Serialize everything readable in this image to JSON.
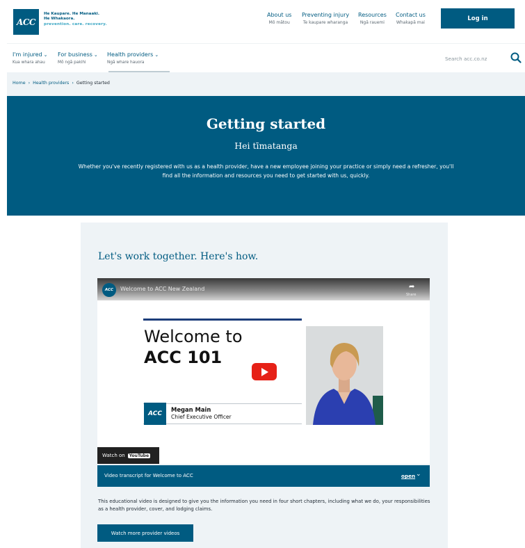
{
  "header": {
    "logo_text": "ACC",
    "tagline_1": "He Kaupare. He Manaaki.",
    "tagline_2": "He Whakaora.",
    "tagline_3": "prevention. care. recovery.",
    "nav": [
      {
        "label": "About us",
        "sub": "Mō mātou"
      },
      {
        "label": "Preventing injury",
        "sub": "Te kaupare wharanga"
      },
      {
        "label": "Resources",
        "sub": "Ngā rauemi"
      },
      {
        "label": "Contact us",
        "sub": "Whakapā mai"
      }
    ],
    "login_label": "Log in"
  },
  "secondary_nav": {
    "items": [
      {
        "label": "I'm injured",
        "sub": "Kua whara ahau"
      },
      {
        "label": "For business",
        "sub": "Mō ngā pakihi"
      },
      {
        "label": "Health providers",
        "sub": "Ngā whare hauora"
      }
    ],
    "search_placeholder": "Search acc.co.nz"
  },
  "breadcrumb": [
    "Home",
    "Health providers",
    "Getting started"
  ],
  "hero": {
    "title": "Getting started",
    "subtitle": "Hei tīmatanga",
    "text": "Whether you've recently registered with us as a health provider, have a new employee joining your practice or simply need a refresher, you'll find all the information and resources you need to get started with us, quickly."
  },
  "card": {
    "heading": "Let's work together. Here's how.",
    "video": {
      "title": "Welcome to ACC New Zealand",
      "share_label": "Share",
      "headline_1": "Welcome to",
      "headline_2": "ACC 101",
      "presenter_name": "Megan Main",
      "presenter_role": "Chief Executive Officer",
      "watch_on": "Watch on",
      "youtube": "YouTube"
    },
    "transcript_label": "Video transcript for Welcome to ACC",
    "transcript_toggle": "open",
    "description": "This educational video is designed to give you the information you need in four short chapters, including what we do, your responsibilities as a health provider, cover, and lodging claims.",
    "more_button": "Watch more provider videos"
  },
  "colors": {
    "brand": "#005b81",
    "card_bg": "#eef3f6",
    "youtube_red": "#e62117"
  }
}
